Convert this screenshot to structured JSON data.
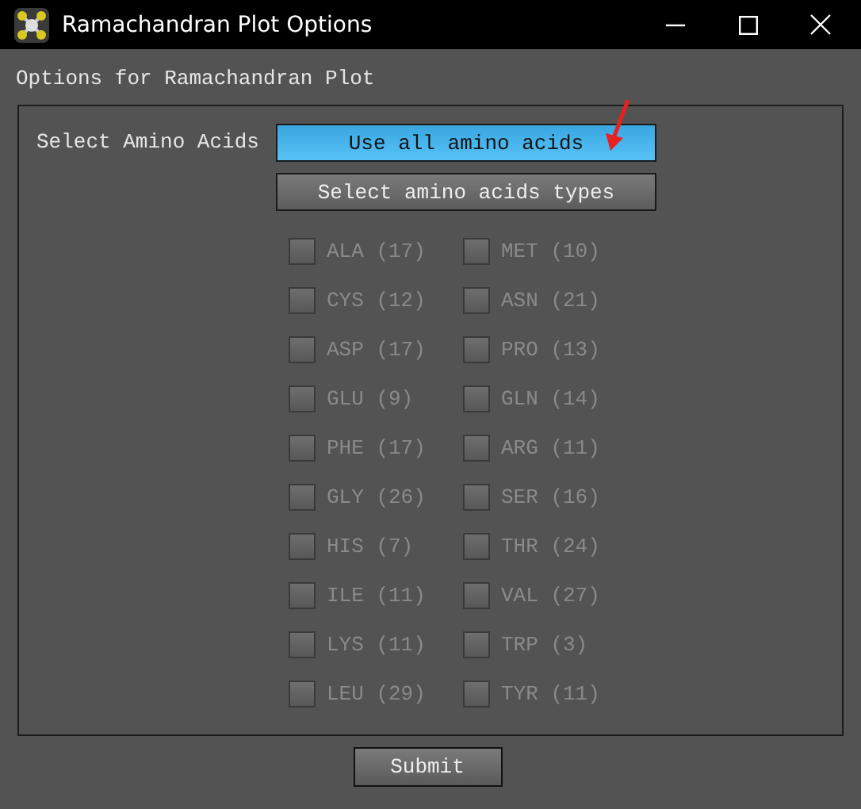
{
  "window": {
    "title": "Ramachandran Plot Options"
  },
  "header": "Options for Ramachandran Plot",
  "select_label": "Select Amino Acids",
  "mode_buttons": [
    {
      "label": "Use all amino acids",
      "selected": true
    },
    {
      "label": "Select amino acids types",
      "selected": false
    }
  ],
  "amino_acids": [
    {
      "label": "ALA (17)",
      "checked": false,
      "disabled": true
    },
    {
      "label": "MET (10)",
      "checked": false,
      "disabled": true
    },
    {
      "label": "CYS (12)",
      "checked": false,
      "disabled": true
    },
    {
      "label": "ASN (21)",
      "checked": false,
      "disabled": true
    },
    {
      "label": "ASP (17)",
      "checked": false,
      "disabled": true
    },
    {
      "label": "PRO (13)",
      "checked": false,
      "disabled": true
    },
    {
      "label": "GLU (9)",
      "checked": false,
      "disabled": true
    },
    {
      "label": "GLN (14)",
      "checked": false,
      "disabled": true
    },
    {
      "label": "PHE (17)",
      "checked": false,
      "disabled": true
    },
    {
      "label": "ARG (11)",
      "checked": false,
      "disabled": true
    },
    {
      "label": "GLY (26)",
      "checked": false,
      "disabled": true
    },
    {
      "label": "SER (16)",
      "checked": false,
      "disabled": true
    },
    {
      "label": "HIS (7)",
      "checked": false,
      "disabled": true
    },
    {
      "label": "THR (24)",
      "checked": false,
      "disabled": true
    },
    {
      "label": "ILE (11)",
      "checked": false,
      "disabled": true
    },
    {
      "label": "VAL (27)",
      "checked": false,
      "disabled": true
    },
    {
      "label": "LYS (11)",
      "checked": false,
      "disabled": true
    },
    {
      "label": "TRP (3)",
      "checked": false,
      "disabled": true
    },
    {
      "label": "LEU (29)",
      "checked": false,
      "disabled": true
    },
    {
      "label": "TYR (11)",
      "checked": false,
      "disabled": true
    }
  ],
  "submit": "Submit"
}
